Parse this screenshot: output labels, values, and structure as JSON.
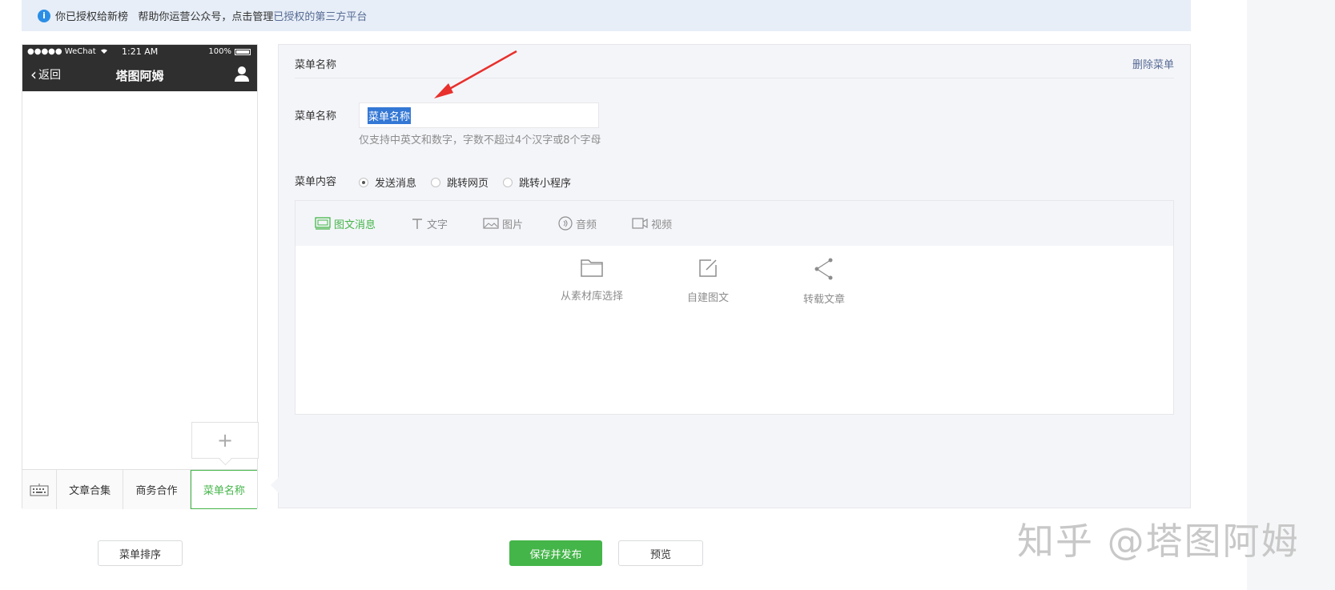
{
  "notice": {
    "text": "你已授权给新榜   帮助你运营公众号，点击管理",
    "link": "已授权的第三方平台",
    "info_icon": "i"
  },
  "phone": {
    "carrier": "●●●●● WeChat",
    "time": "1:21 AM",
    "battery": "100%",
    "back_label": "返回",
    "title": "塔图阿姆",
    "add_symbol": "+",
    "menu": [
      {
        "label": "文章合集"
      },
      {
        "label": "商务合作"
      },
      {
        "label": "菜单名称"
      }
    ]
  },
  "editor": {
    "title": "菜单名称",
    "delete_label": "删除菜单",
    "name_label": "菜单名称",
    "name_value": "菜单名称",
    "hint": "仅支持中英文和数字，字数不超过4个汉字或8个字母",
    "content_label": "菜单内容",
    "radios": [
      {
        "label": "发送消息",
        "checked": true
      },
      {
        "label": "跳转网页",
        "checked": false
      },
      {
        "label": "跳转小程序",
        "checked": false
      }
    ],
    "tabs": [
      {
        "label": "图文消息",
        "icon": "news-icon"
      },
      {
        "label": "文字",
        "icon": "text-icon"
      },
      {
        "label": "图片",
        "icon": "image-icon"
      },
      {
        "label": "音频",
        "icon": "audio-icon"
      },
      {
        "label": "视频",
        "icon": "video-icon"
      }
    ],
    "choices": [
      {
        "label": "从素材库选择",
        "icon": "folder-icon"
      },
      {
        "label": "自建图文",
        "icon": "edit-icon"
      },
      {
        "label": "转载文章",
        "icon": "share-icon"
      }
    ]
  },
  "buttons": {
    "sort": "菜单排序",
    "save": "保存并发布",
    "preview": "预览"
  },
  "watermark": "知乎 @塔图阿姆",
  "colors": {
    "accent": "#44b549",
    "link": "#576b95",
    "annotation_arrow": "#e8302c"
  }
}
